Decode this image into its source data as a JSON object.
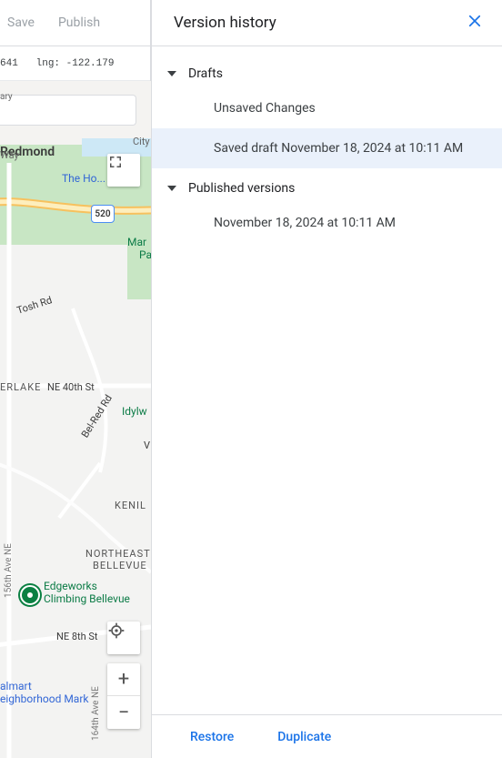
{
  "toolbar": {
    "save": "Save",
    "publish": "Publish"
  },
  "coords": {
    "lat_val": "641",
    "lng_label": "lng:",
    "lng_val": "-122.179"
  },
  "map": {
    "redmond": "Redmond",
    "homedepot": "The Ho...  ep...",
    "marymoor_frag": "Mar",
    "pa_frag": "Pa",
    "tosh": "Tosh Rd",
    "erlake": "ERLAKE",
    "ne40": "NE 40th St",
    "idylw": "Idylw",
    "belred": "Bel-Red Rd",
    "v": "V",
    "kenil": "KENIL",
    "ne_bellevue_1": "NORTHEAST",
    "ne_bellevue_2": "BELLEVUE",
    "edgeworks_1": "Edgeworks",
    "edgeworks_2": "Climbing Bellevue",
    "ne8": "NE 8th St",
    "walmart_1": "almart",
    "walmart_2": "eighborhood Mark",
    "ave_156": "156th Ave NE",
    "ave_164": "164th Ave NE",
    "route": "520",
    "city_frag": "City",
    "way_frag": "Way",
    "library_frag": "ary"
  },
  "panel": {
    "title": "Version history",
    "sections": [
      {
        "title": "Drafts",
        "items": [
          {
            "label": "Unsaved Changes",
            "selected": false
          },
          {
            "label": "Saved draft November 18, 2024 at 10:11 AM",
            "selected": true
          }
        ]
      },
      {
        "title": "Published versions",
        "items": [
          {
            "label": "November 18, 2024 at 10:11 AM",
            "selected": false
          }
        ]
      }
    ],
    "actions": {
      "restore": "Restore",
      "duplicate": "Duplicate"
    }
  }
}
